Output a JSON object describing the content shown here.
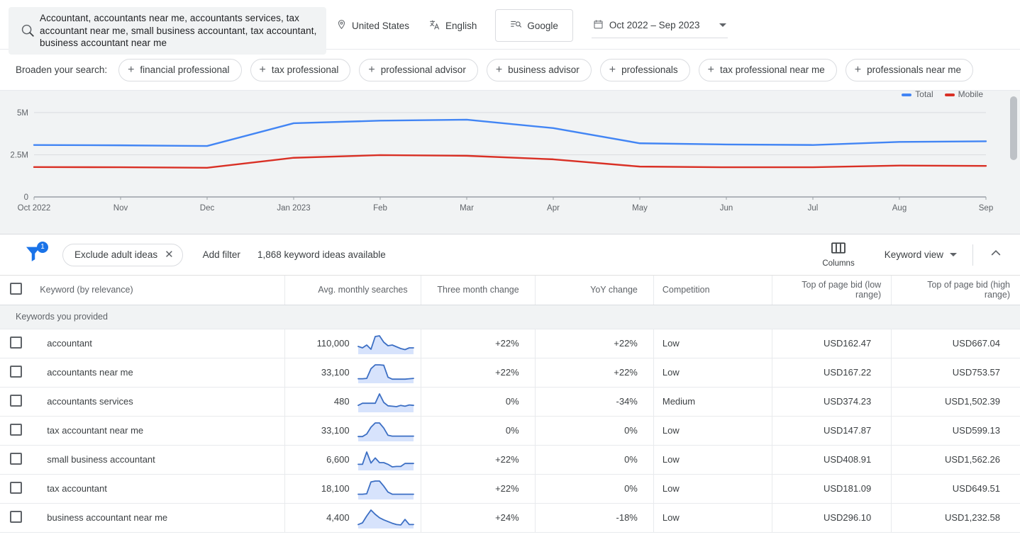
{
  "search": {
    "icon": "search-icon",
    "terms": "Accountant, accountants near me, accountants services, tax accountant near me, small business accountant, tax accountant, business accountant near me"
  },
  "top_controls": {
    "location": "United States",
    "location_icon": "location-pin-icon",
    "language": "English",
    "language_icon": "translate-icon",
    "network": "Google",
    "network_icon": "search-network-icon",
    "date_range": "Oct 2022 – Sep 2023",
    "date_icon": "calendar-icon",
    "date_dropdown_icon": "chevron-down-icon"
  },
  "broaden": {
    "label": "Broaden your search:",
    "chips": [
      "financial professional",
      "tax professional",
      "professional advisor",
      "business advisor",
      "professionals",
      "tax professional near me",
      "professionals near me"
    ]
  },
  "chart_data": {
    "type": "line",
    "title": "",
    "xlabel": "",
    "ylabel": "",
    "ylim": [
      0,
      5500000
    ],
    "yticks": [
      0,
      2500000,
      5000000
    ],
    "ytick_labels": [
      "0",
      "2.5M",
      "5M"
    ],
    "grid": true,
    "legend_position": "top-right",
    "categories": [
      "Oct 2022",
      "Nov",
      "Dec",
      "Jan 2023",
      "Feb",
      "Mar",
      "Apr",
      "May",
      "Jun",
      "Jul",
      "Aug",
      "Sep"
    ],
    "series": [
      {
        "name": "Total",
        "color": "#4285f4",
        "values": [
          3080000,
          3060000,
          3020000,
          4370000,
          4520000,
          4580000,
          4080000,
          3180000,
          3110000,
          3080000,
          3260000,
          3300000
        ]
      },
      {
        "name": "Mobile",
        "color": "#d93025",
        "values": [
          1770000,
          1760000,
          1730000,
          2320000,
          2480000,
          2440000,
          2230000,
          1800000,
          1760000,
          1760000,
          1860000,
          1840000
        ]
      }
    ]
  },
  "toolbar": {
    "filter_icon": "filter-icon",
    "filter_badge": "1",
    "active_filter": "Exclude adult ideas",
    "remove_filter_icon": "close-icon",
    "add_filter": "Add filter",
    "ideas_count": "1,868 keyword ideas available",
    "columns_icon": "columns-icon",
    "columns_label": "Columns",
    "view_label": "Keyword view",
    "view_dropdown_icon": "chevron-down-icon",
    "collapse_icon": "chevron-up-icon"
  },
  "table": {
    "columns": [
      "Keyword (by relevance)",
      "Avg. monthly searches",
      "Three month change",
      "YoY change",
      "Competition",
      "Top of page bid (low range)",
      "Top of page bid (high range)"
    ],
    "group_label": "Keywords you provided",
    "rows": [
      {
        "keyword": "accountant",
        "avg_monthly_searches": "110,000",
        "three_month_change": "+22%",
        "yoy_change": "+22%",
        "competition": "Low",
        "bid_low": "USD162.47",
        "bid_high": "USD667.04",
        "spark": [
          18,
          14,
          22,
          10,
          46,
          48,
          30,
          20,
          22,
          17,
          12,
          9,
          14,
          14
        ]
      },
      {
        "keyword": "accountants near me",
        "avg_monthly_searches": "33,100",
        "three_month_change": "+22%",
        "yoy_change": "+22%",
        "competition": "Low",
        "bid_low": "USD167.22",
        "bid_high": "USD753.57",
        "spark": [
          8,
          8,
          9,
          34,
          44,
          44,
          43,
          12,
          7,
          7,
          7,
          7,
          8,
          9
        ]
      },
      {
        "keyword": "accountants services",
        "avg_monthly_searches": "480",
        "three_month_change": "0%",
        "yoy_change": "-34%",
        "competition": "Medium",
        "bid_low": "USD374.23",
        "bid_high": "USD1,502.39",
        "spark": [
          13,
          18,
          18,
          18,
          18,
          40,
          20,
          12,
          11,
          10,
          13,
          11,
          14,
          13
        ]
      },
      {
        "keyword": "tax accountant near me",
        "avg_monthly_searches": "33,100",
        "three_month_change": "0%",
        "yoy_change": "0%",
        "competition": "Low",
        "bid_low": "USD147.87",
        "bid_high": "USD599.13",
        "spark": [
          8,
          8,
          14,
          30,
          40,
          40,
          28,
          11,
          9,
          9,
          9,
          9,
          9,
          9
        ]
      },
      {
        "keyword": "small business accountant",
        "avg_monthly_searches": "6,600",
        "three_month_change": "+22%",
        "yoy_change": "0%",
        "competition": "Low",
        "bid_low": "USD408.91",
        "bid_high": "USD1,562.26",
        "spark": [
          11,
          11,
          40,
          14,
          26,
          15,
          15,
          11,
          5,
          6,
          6,
          13,
          13,
          13
        ]
      },
      {
        "keyword": "tax accountant",
        "avg_monthly_searches": "18,100",
        "three_month_change": "+22%",
        "yoy_change": "0%",
        "competition": "Low",
        "bid_low": "USD181.09",
        "bid_high": "USD649.51",
        "spark": [
          9,
          9,
          10,
          38,
          40,
          40,
          28,
          14,
          9,
          9,
          9,
          9,
          9,
          9
        ]
      },
      {
        "keyword": "business accountant near me",
        "avg_monthly_searches": "4,400",
        "three_month_change": "+24%",
        "yoy_change": "-18%",
        "competition": "Low",
        "bid_low": "USD296.10",
        "bid_high": "USD1,232.58",
        "spark": [
          6,
          10,
          26,
          40,
          30,
          22,
          17,
          13,
          9,
          6,
          5,
          18,
          6,
          6
        ]
      }
    ]
  }
}
